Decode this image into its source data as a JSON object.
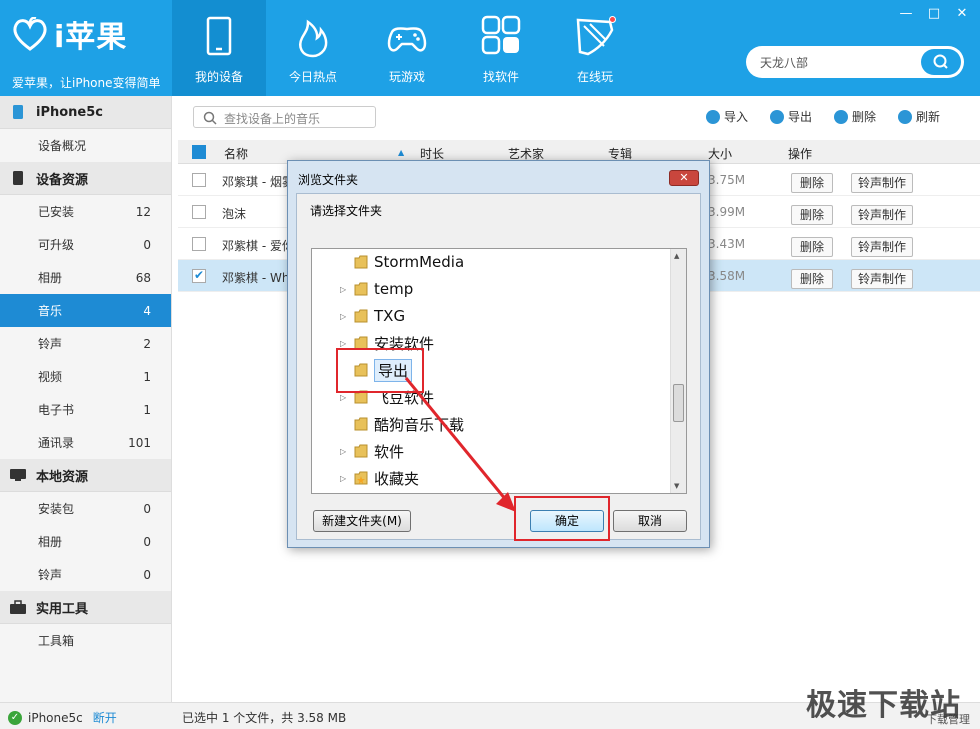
{
  "app": {
    "logo_text": "i苹果",
    "slogan": "爱苹果，让iPhone变得简单"
  },
  "nav": [
    {
      "label": "我的设备",
      "icon": "tablet-icon"
    },
    {
      "label": "今日热点",
      "icon": "flame-icon"
    },
    {
      "label": "玩游戏",
      "icon": "gamepad-icon"
    },
    {
      "label": "找软件",
      "icon": "apps-grid-icon"
    },
    {
      "label": "在线玩",
      "icon": "rocket-icon"
    }
  ],
  "window_controls": [
    "—",
    "□",
    "✕"
  ],
  "search": {
    "value": "天龙八部"
  },
  "sidebar": {
    "device": "iPhone5c",
    "overview": "设备概况",
    "sections": [
      {
        "title": "设备资源",
        "items": [
          {
            "label": "已安装",
            "count": "12"
          },
          {
            "label": "可升级",
            "count": "0"
          },
          {
            "label": "相册",
            "count": "68"
          },
          {
            "label": "音乐",
            "count": "4"
          },
          {
            "label": "铃声",
            "count": "2"
          },
          {
            "label": "视频",
            "count": "1"
          },
          {
            "label": "电子书",
            "count": "1"
          },
          {
            "label": "通讯录",
            "count": "101"
          }
        ]
      },
      {
        "title": "本地资源",
        "items": [
          {
            "label": "安装包",
            "count": "0"
          },
          {
            "label": "相册",
            "count": "0"
          },
          {
            "label": "铃声",
            "count": "0"
          }
        ]
      },
      {
        "title": "实用工具",
        "items": [
          {
            "label": "工具箱",
            "count": ""
          }
        ]
      }
    ]
  },
  "content": {
    "search_placeholder": "查找设备上的音乐",
    "toolbar": [
      "导入",
      "导出",
      "删除",
      "刷新"
    ],
    "columns": {
      "name": "名称",
      "duration": "时长",
      "artist": "艺术家",
      "album": "专辑",
      "size": "大小",
      "action": "操作"
    },
    "rows": [
      {
        "name": "邓紫琪 - 烟雾",
        "size": "3.75M",
        "selected": false
      },
      {
        "name": "泡沫",
        "size": "3.99M",
        "selected": false
      },
      {
        "name": "邓紫棋 - 爱你",
        "size": "3.43M",
        "selected": false
      },
      {
        "name": "邓紫棋 - Wh",
        "size": "3.58M",
        "selected": true
      }
    ],
    "delete_label": "删除",
    "ringtone_label": "铃声制作"
  },
  "dialog": {
    "title": "浏览文件夹",
    "close": "✕",
    "prompt": "请选择文件夹",
    "folders": [
      {
        "name": "StormMedia",
        "expandable": false
      },
      {
        "name": "temp",
        "expandable": true
      },
      {
        "name": "TXG",
        "expandable": true
      },
      {
        "name": "安装软件",
        "expandable": true
      },
      {
        "name": "导出",
        "expandable": false,
        "selected": true
      },
      {
        "name": "飞豆软件",
        "expandable": true
      },
      {
        "name": "酷狗音乐下载",
        "expandable": false
      },
      {
        "name": "软件",
        "expandable": true
      },
      {
        "name": "收藏夹",
        "expandable": true
      }
    ],
    "new_folder": "新建文件夹(M)",
    "ok": "确定",
    "cancel": "取消"
  },
  "status": {
    "device": "iPhone5c",
    "disconnect": "断开",
    "info": "已选中 1 个文件，共 3.58 MB",
    "download_manager": "下载管理"
  },
  "watermark": "极速下载站",
  "colors": {
    "accent": "#1ea1e6",
    "active": "#1e8bd4",
    "annotation": "#e0262c"
  }
}
